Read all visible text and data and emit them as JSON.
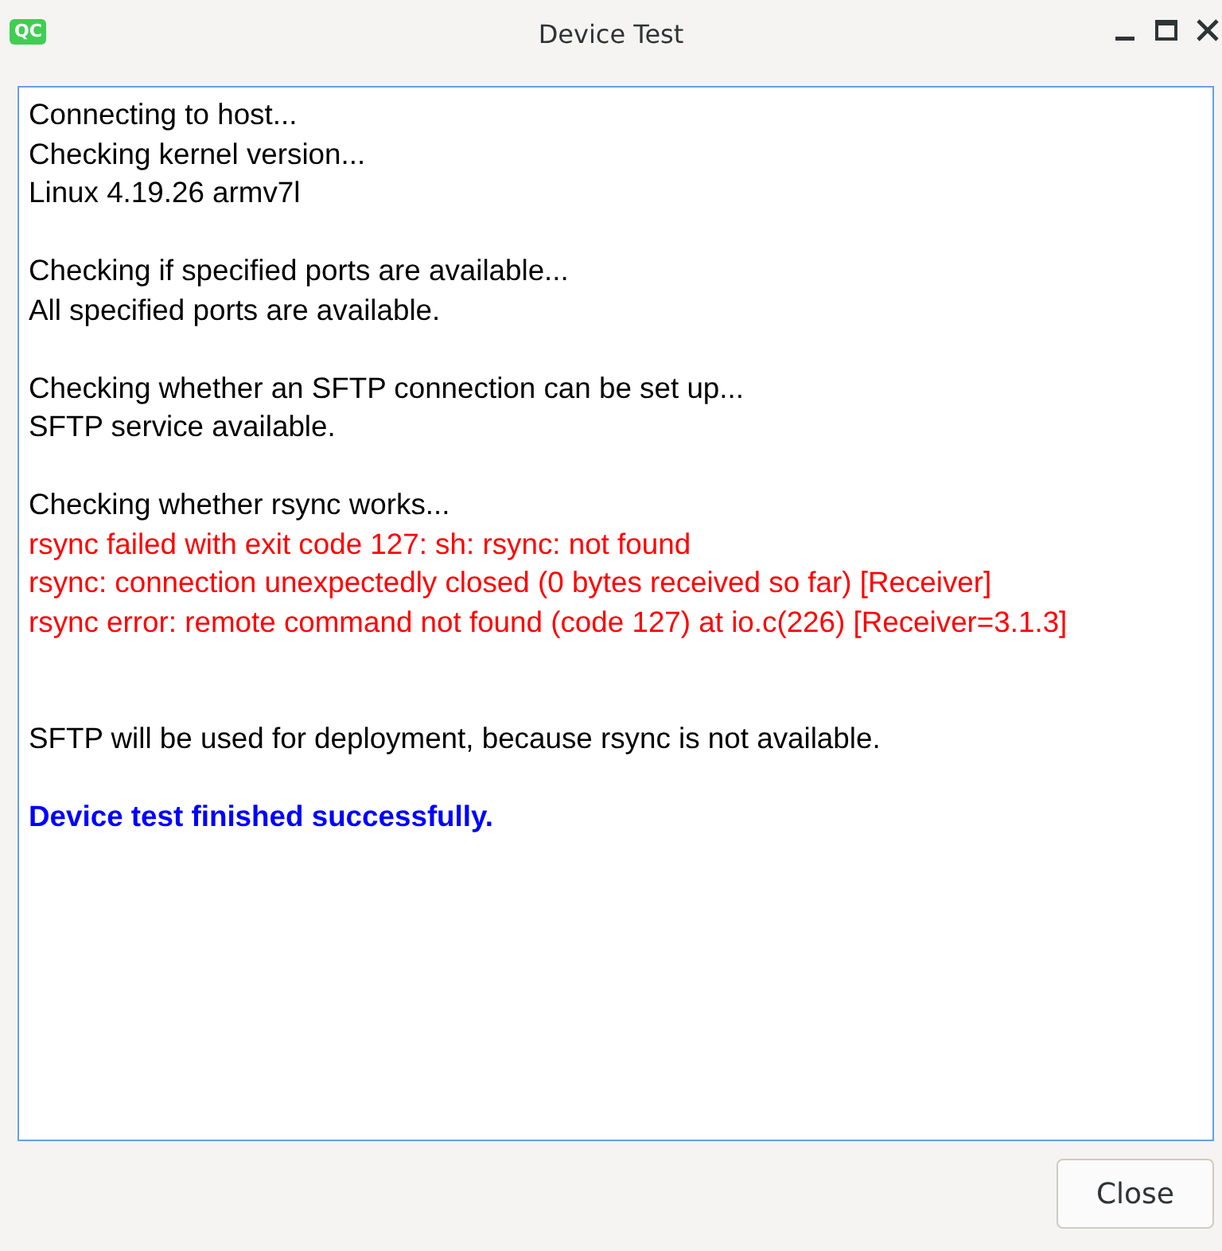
{
  "window": {
    "title": "Device Test",
    "app_icon": "QC"
  },
  "log": [
    {
      "kind": "normal",
      "text": "Connecting to host..."
    },
    {
      "kind": "normal",
      "text": "Checking kernel version..."
    },
    {
      "kind": "normal",
      "text": "Linux 4.19.26 armv7l"
    },
    {
      "kind": "blank"
    },
    {
      "kind": "normal",
      "text": "Checking if specified ports are available..."
    },
    {
      "kind": "normal",
      "text": "All specified ports are available."
    },
    {
      "kind": "blank"
    },
    {
      "kind": "normal",
      "text": "Checking whether an SFTP connection can be set up..."
    },
    {
      "kind": "normal",
      "text": "SFTP service available."
    },
    {
      "kind": "blank"
    },
    {
      "kind": "normal",
      "text": "Checking whether rsync works..."
    },
    {
      "kind": "error",
      "text": "rsync failed with exit code 127: sh: rsync: not found"
    },
    {
      "kind": "error",
      "text": "rsync: connection unexpectedly closed (0 bytes received so far) [Receiver]"
    },
    {
      "kind": "error",
      "text": "rsync error: remote command not found (code 127) at io.c(226) [Receiver=3.1.3]"
    },
    {
      "kind": "blank"
    },
    {
      "kind": "blank"
    },
    {
      "kind": "normal",
      "text": "SFTP will be used for deployment, because rsync is not available."
    },
    {
      "kind": "blank"
    },
    {
      "kind": "success",
      "text": "Device test finished successfully."
    }
  ],
  "buttons": [
    "Close"
  ]
}
